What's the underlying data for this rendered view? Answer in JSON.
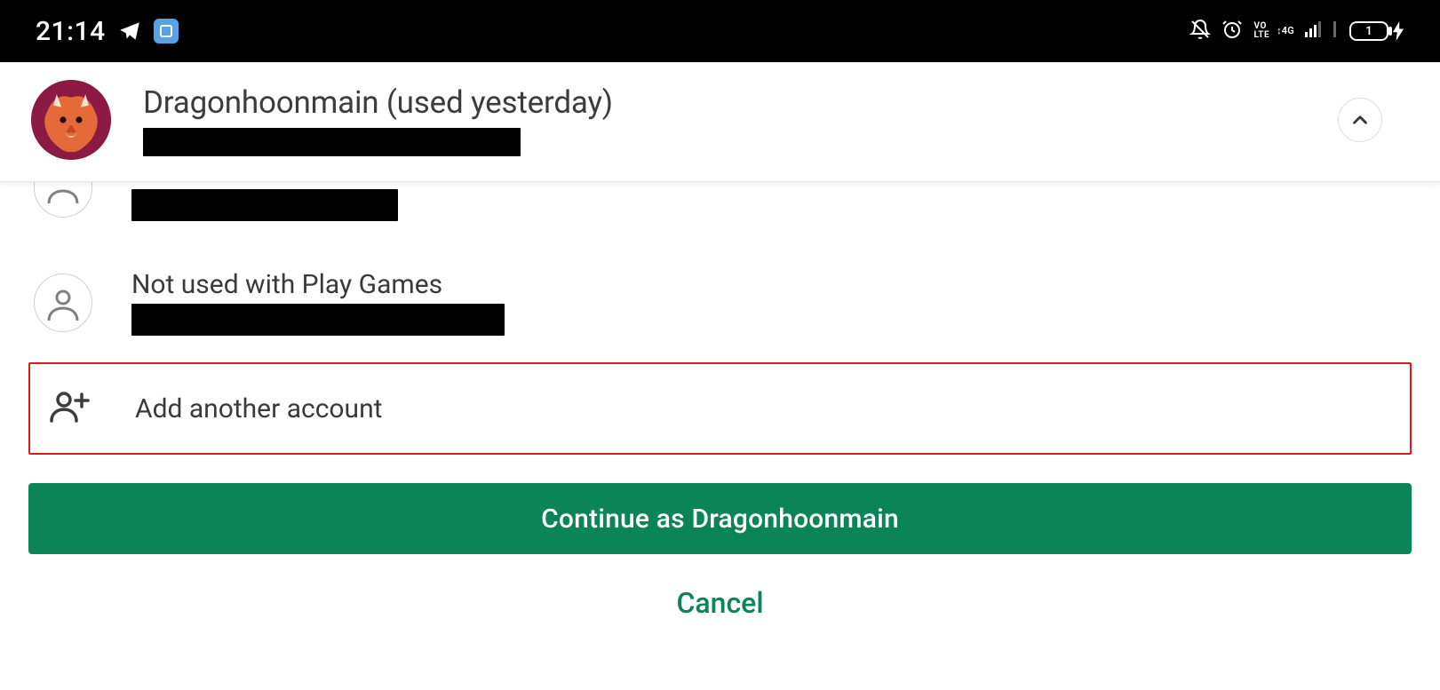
{
  "status_bar": {
    "time": "21:14",
    "volte_top": "VO",
    "volte_bottom": "LTE",
    "net_top": "↕4G",
    "battery_text": "1"
  },
  "selected_account": {
    "display_name": "Dragonhoonmain (used yesterday)",
    "redacted_email_width": 425
  },
  "accounts": {
    "partial_top": {
      "redacted_width": 300
    },
    "second": {
      "label": "Not used with Play Games",
      "redacted_width": 420
    }
  },
  "add_account": {
    "label": "Add another account"
  },
  "buttons": {
    "primary": "Continue as Dragonhoonmain",
    "cancel": "Cancel"
  },
  "colors": {
    "primary_green": "#0b8457",
    "highlight_red": "#e11818"
  }
}
